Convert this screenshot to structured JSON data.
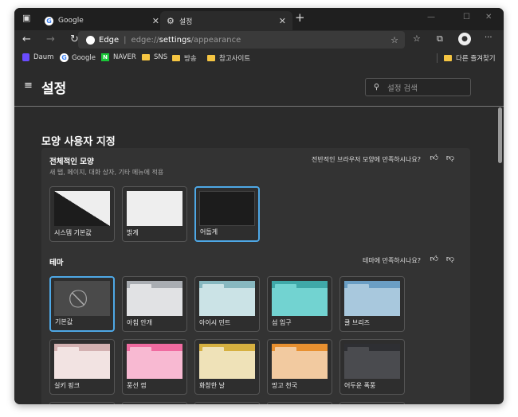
{
  "tabs": [
    {
      "label": "Google",
      "icon": "google-icon"
    },
    {
      "label": "설정",
      "icon": "gear-icon"
    }
  ],
  "address": {
    "brand": "Edge",
    "prefix": "edge://",
    "bold": "settings",
    "suffix": "/appearance"
  },
  "bookmarks": [
    {
      "label": "Daum"
    },
    {
      "label": "Google"
    },
    {
      "label": "NAVER"
    },
    {
      "label": "SNS"
    },
    {
      "label": "방송"
    },
    {
      "label": "참고사이트"
    }
  ],
  "other_bookmarks": "다른 즐겨찾기",
  "header": {
    "title": "설정",
    "search_placeholder": "설정 검색"
  },
  "page_title": "모양 사용자 지정",
  "appearance": {
    "title": "전체적인 모양",
    "subtitle": "새 탭, 페이지, 대화 상자, 기타 메뉴에 적용",
    "feedback": "전반적인 브라우저 모양에 만족하시나요?",
    "options": [
      {
        "label": "시스템 기본값"
      },
      {
        "label": "밝게"
      },
      {
        "label": "어둡게",
        "selected": true
      }
    ]
  },
  "theme": {
    "title": "테마",
    "feedback": "테마에 만족하시나요?",
    "options": [
      {
        "label": "기본값",
        "selected": true
      },
      {
        "label": "아침 안개",
        "top": "#a9adb2",
        "body": "#e1e2e4"
      },
      {
        "label": "아이시 민트",
        "top": "#87b8c0",
        "body": "#cbe3e6"
      },
      {
        "label": "섬 입구",
        "top": "#3fa8a8",
        "body": "#72d3d1"
      },
      {
        "label": "쿨 브리즈",
        "top": "#6a9ec4",
        "body": "#a8c8dd"
      },
      {
        "label": "실키 핑크",
        "top": "#d3b1b1",
        "body": "#f2e3e2"
      },
      {
        "label": "풍선 껌",
        "top": "#f06ba0",
        "body": "#f8b9d2"
      },
      {
        "label": "화창한 날",
        "top": "#d6b040",
        "body": "#efe2b8"
      },
      {
        "label": "망고 천국",
        "top": "#e89030",
        "body": "#f2caa0"
      },
      {
        "label": "어두운 폭풍",
        "top": "#2e2f33",
        "body": "#4a4b4f"
      }
    ]
  }
}
